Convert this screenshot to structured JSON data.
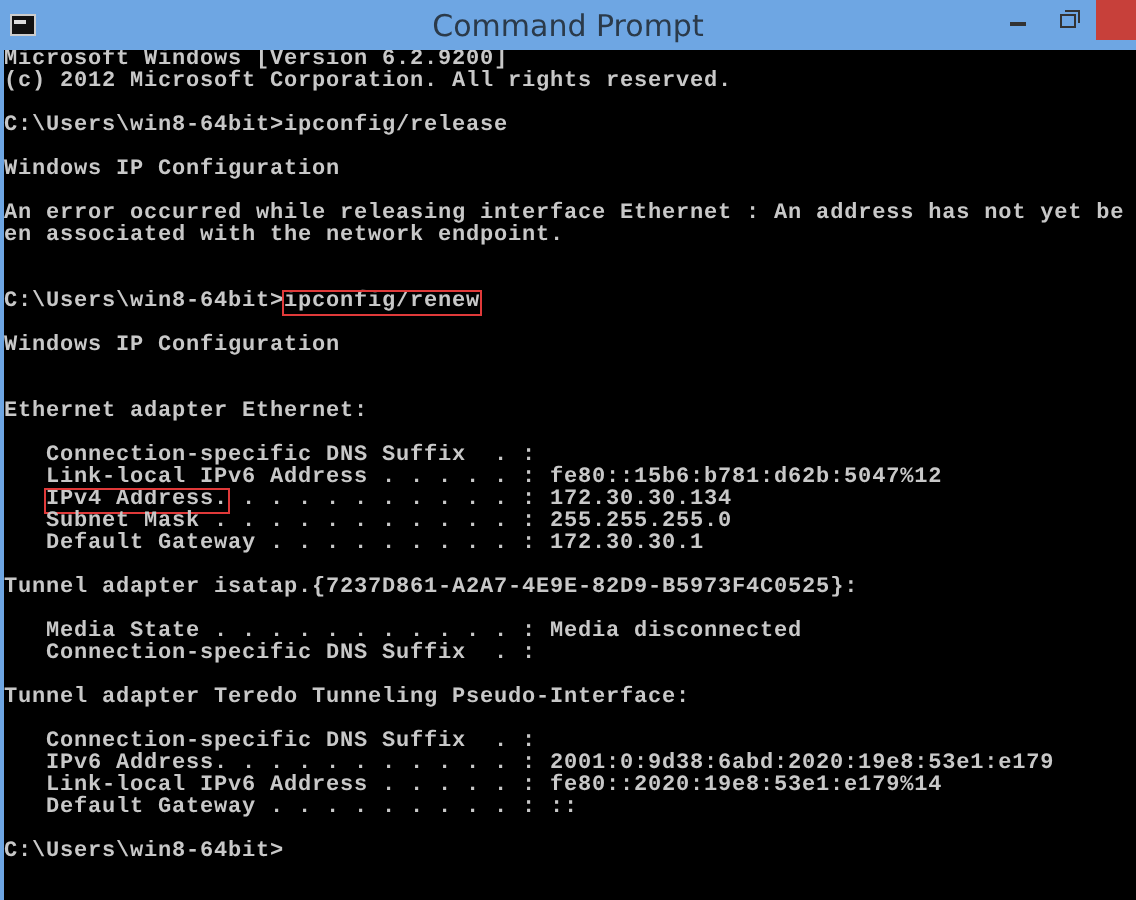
{
  "window": {
    "title": "Command Prompt"
  },
  "console": {
    "lines": [
      {
        "kind": "text",
        "text": "Microsoft Windows [Version 6.2.9200]"
      },
      {
        "kind": "text",
        "text": "(c) 2012 Microsoft Corporation. All rights reserved."
      },
      {
        "kind": "blank"
      },
      {
        "kind": "text",
        "text": "C:\\Users\\win8-64bit>ipconfig/release"
      },
      {
        "kind": "blank"
      },
      {
        "kind": "text",
        "text": "Windows IP Configuration"
      },
      {
        "kind": "blank"
      },
      {
        "kind": "text",
        "text": "An error occurred while releasing interface Ethernet : An address has not yet be"
      },
      {
        "kind": "text",
        "text": "en associated with the network endpoint."
      },
      {
        "kind": "blank"
      },
      {
        "kind": "blank"
      },
      {
        "kind": "text",
        "segments": [
          {
            "text": "C:\\Users\\win8-64bit>",
            "highlighted": false
          },
          {
            "text": "ipconfig/renew",
            "highlighted": true
          }
        ]
      },
      {
        "kind": "blank"
      },
      {
        "kind": "text",
        "text": "Windows IP Configuration"
      },
      {
        "kind": "blank"
      },
      {
        "kind": "blank"
      },
      {
        "kind": "text",
        "text": "Ethernet adapter Ethernet:"
      },
      {
        "kind": "blank"
      },
      {
        "kind": "field",
        "text": "Connection-specific DNS Suffix  . :"
      },
      {
        "kind": "field",
        "text": "Link-local IPv6 Address . . . . . : fe80::15b6:b781:d62b:5047%12"
      },
      {
        "kind": "field",
        "segments": [
          {
            "text": "IPv4 Address.",
            "highlighted": true
          },
          {
            "text": " . . . . . . . . . . : 172.30.30.134",
            "highlighted": false
          }
        ]
      },
      {
        "kind": "field",
        "text": "Subnet Mask . . . . . . . . . . . : 255.255.255.0"
      },
      {
        "kind": "field",
        "text": "Default Gateway . . . . . . . . . : 172.30.30.1"
      },
      {
        "kind": "blank"
      },
      {
        "kind": "text",
        "text": "Tunnel adapter isatap.{7237D861-A2A7-4E9E-82D9-B5973F4C0525}:"
      },
      {
        "kind": "blank"
      },
      {
        "kind": "field",
        "text": "Media State . . . . . . . . . . . : Media disconnected"
      },
      {
        "kind": "field",
        "text": "Connection-specific DNS Suffix  . :"
      },
      {
        "kind": "blank"
      },
      {
        "kind": "text",
        "text": "Tunnel adapter Teredo Tunneling Pseudo-Interface:"
      },
      {
        "kind": "blank"
      },
      {
        "kind": "field",
        "text": "Connection-specific DNS Suffix  . :"
      },
      {
        "kind": "field",
        "text": "IPv6 Address. . . . . . . . . . . : 2001:0:9d38:6abd:2020:19e8:53e1:e179"
      },
      {
        "kind": "field",
        "text": "Link-local IPv6 Address . . . . . : fe80::2020:19e8:53e1:e179%14"
      },
      {
        "kind": "field",
        "text": "Default Gateway . . . . . . . . . : ::"
      },
      {
        "kind": "blank"
      },
      {
        "kind": "text",
        "text": "C:\\Users\\win8-64bit>"
      }
    ]
  }
}
